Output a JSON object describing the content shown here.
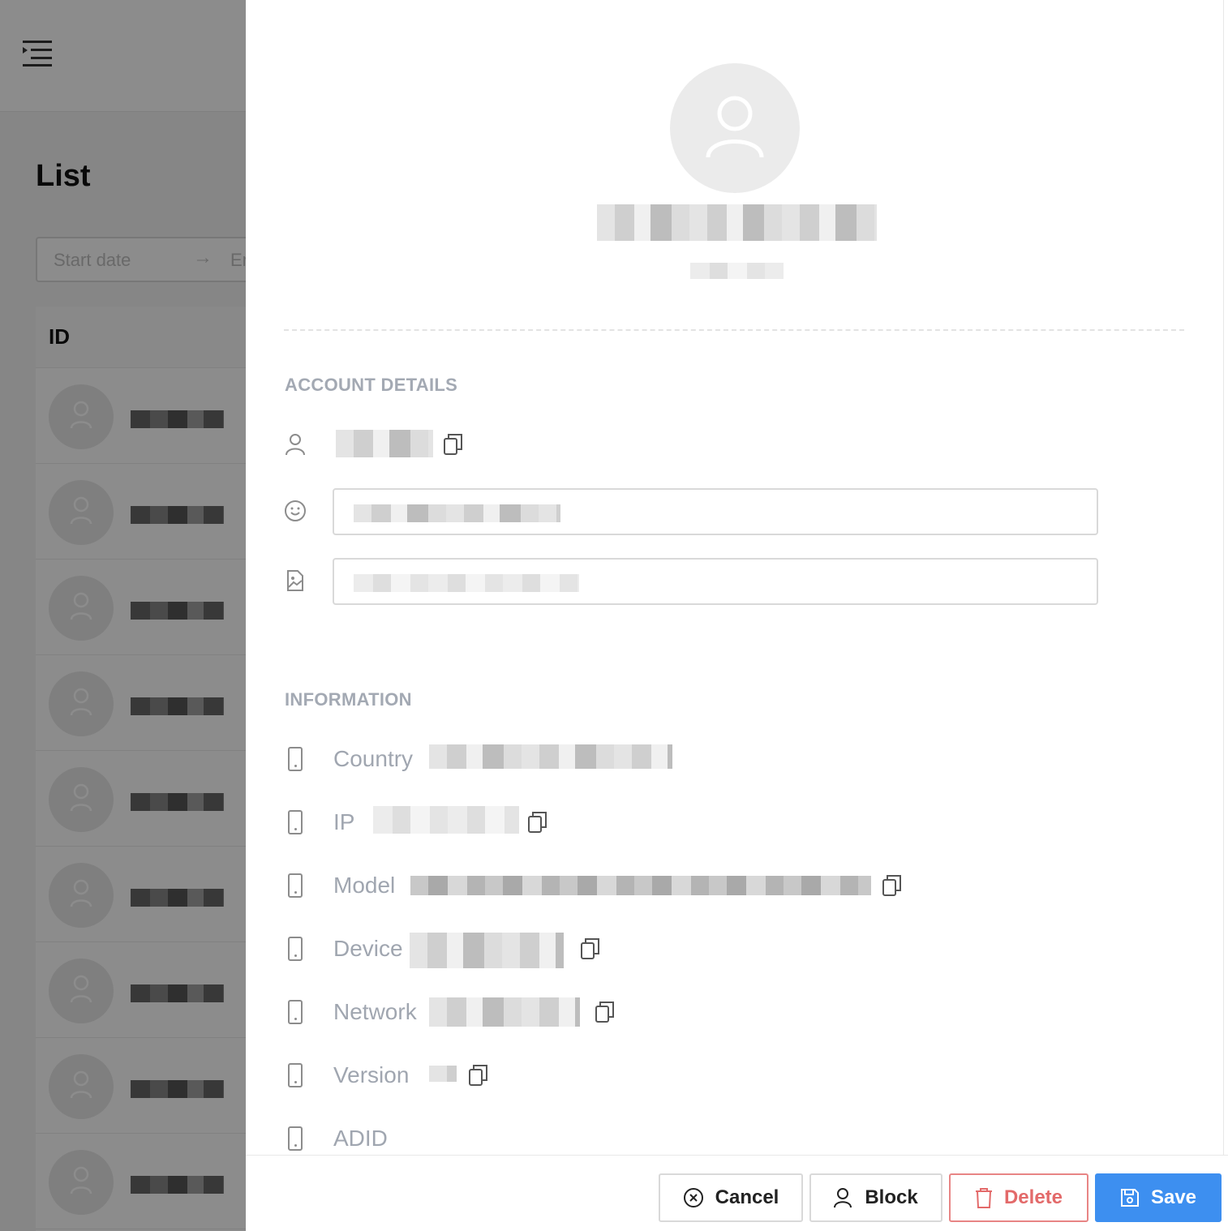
{
  "background": {
    "page_title": "List",
    "date_range": {
      "start_placeholder": "Start date",
      "arrow": "→",
      "end_placeholder": "Er"
    },
    "table": {
      "column_id": "ID"
    }
  },
  "drawer": {
    "sections": {
      "account": "ACCOUNT DETAILS",
      "information": "INFORMATION"
    },
    "info_labels": {
      "country": "Country",
      "ip": "IP",
      "model": "Model",
      "device": "Device",
      "network": "Network",
      "version": "Version",
      "adid": "ADID"
    }
  },
  "footer": {
    "cancel": "Cancel",
    "block": "Block",
    "delete": "Delete",
    "save": "Save"
  },
  "colors": {
    "primary": "#3d8ff0",
    "danger": "#e36a6a",
    "section_title": "#a3a9b3"
  },
  "icons": [
    "menu-fold-icon",
    "user-icon",
    "smile-icon",
    "file-image-icon",
    "copy-icon",
    "mobile-icon",
    "close-circle-icon",
    "delete-icon",
    "save-icon"
  ]
}
